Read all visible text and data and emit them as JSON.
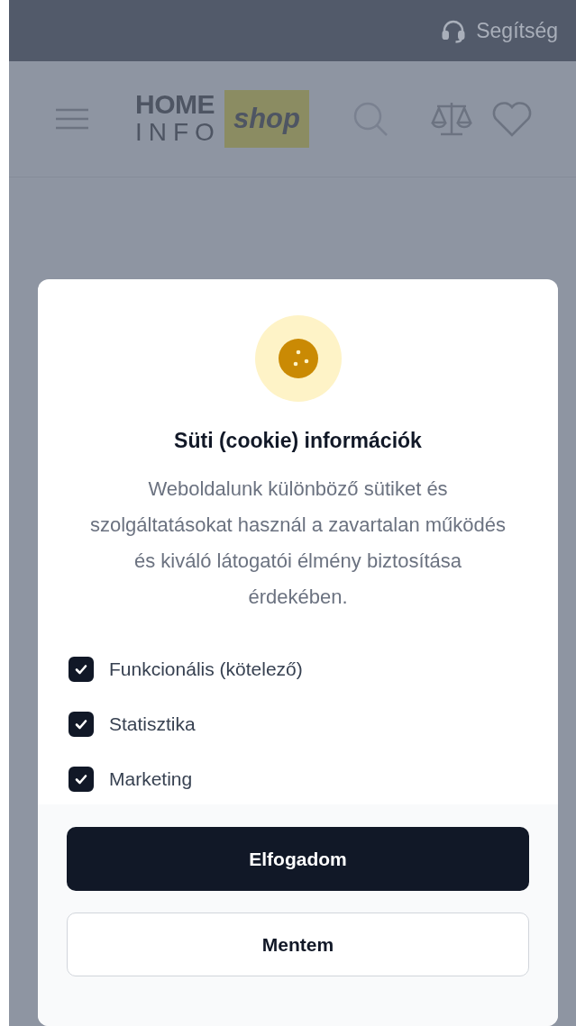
{
  "top_bar": {
    "help_label": "Segítség"
  },
  "header": {
    "logo": {
      "word_1": "HOME",
      "word_2": "INFO",
      "badge": "shop"
    }
  },
  "cookie_dialog": {
    "title": "Süti (cookie) információk",
    "description": "Weboldalunk különböző sütiket és szolgáltatásokat használ a zavartalan működés és kiváló látogatói élmény biztosítása érdekében.",
    "options": [
      {
        "label": "Funkcionális (kötelező)",
        "checked": true
      },
      {
        "label": "Statisztika",
        "checked": true
      },
      {
        "label": "Marketing",
        "checked": true
      }
    ],
    "buttons": [
      {
        "label": "Elfogadom",
        "kind": "primary"
      },
      {
        "label": "Mentem",
        "kind": "secondary"
      }
    ]
  }
}
